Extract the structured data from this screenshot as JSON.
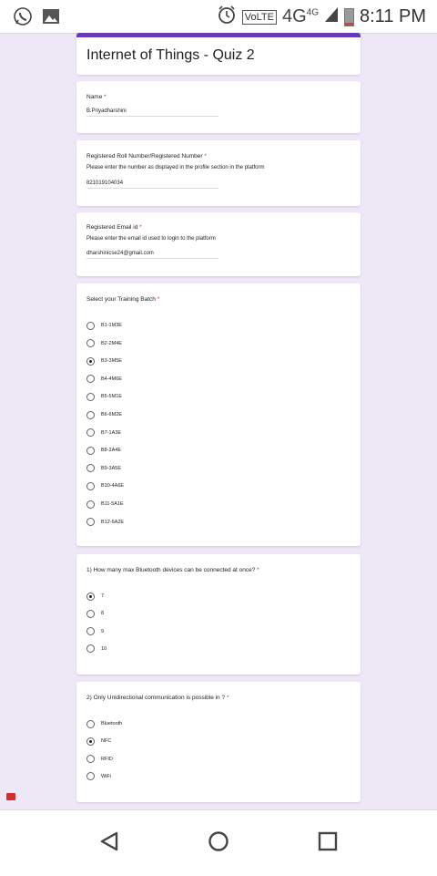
{
  "status_bar": {
    "icons": [
      "whatsapp-icon",
      "gallery-icon",
      "alarm-icon"
    ],
    "volte": "VoLTE",
    "network": "4G",
    "network_sup": "4G",
    "time": "8:11 PM"
  },
  "form": {
    "title": "Internet of Things - Quiz 2",
    "questions": {
      "name": {
        "label": "Name",
        "required": "*",
        "value": "B.Priyadharshini"
      },
      "roll": {
        "label": "Registered Roll Number/Registered Number",
        "required": "*",
        "description": "Please enter the number as displayed in the profile section in the platform",
        "value": "821019104034"
      },
      "email": {
        "label": "Registered Email id",
        "required": "*",
        "description": "Please enter the email id used to login to the platform",
        "value": "dharshinicse24@gmail.com"
      },
      "batch": {
        "label": "Select your Training Batch",
        "required": "*",
        "options": [
          "B1-1M3E",
          "B2-2M4E",
          "B3-3M5E",
          "B4-4M6E",
          "B5-5M1E",
          "B6-6M2E",
          "B7-1A3E",
          "B8-2A4E",
          "B9-3A5E",
          "B10-4A6E",
          "B11-5A1E",
          "B12-6A2E"
        ],
        "selected": "B3-3M5E"
      },
      "q1": {
        "label": "1) How many max Bluetooth devices can be connected at once?",
        "required": "*",
        "options": [
          "7",
          "8",
          "9",
          "10"
        ],
        "selected": "7"
      },
      "q2": {
        "label": "2) Only Unidirectional communication is possible in ?",
        "required": "*",
        "options": [
          "Bluetooth",
          "NFC",
          "RFID",
          "WiFi"
        ],
        "selected": "NFC"
      }
    }
  },
  "nav": {
    "icons": [
      "back-icon",
      "home-icon",
      "recents-icon"
    ]
  },
  "colors": {
    "accent": "#673ab7",
    "background": "#ede7f6",
    "required": "#d93025"
  }
}
